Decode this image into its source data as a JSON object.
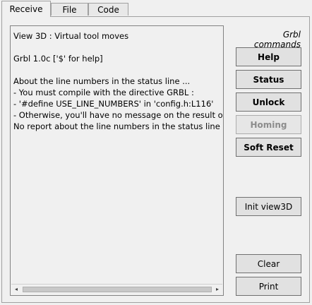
{
  "tabs": [
    {
      "label": "Receive",
      "active": true
    },
    {
      "label": "File",
      "active": false
    },
    {
      "label": "Code",
      "active": false
    }
  ],
  "console": {
    "lines": [
      "View 3D : Virtual tool moves",
      "",
      "Grbl 1.0c ['$' for help]",
      "",
      "About the line numbers in the status line ...",
      "- You must compile with the directive GRBL :",
      "- '#define USE_LINE_NUMBERS' in 'config.h:L116'",
      "- Otherwise, you'll have no message on the result of",
      "No report about the line numbers in the status line !"
    ],
    "scroll_left_arrow": "◂",
    "scroll_right_arrow": "▸"
  },
  "commands": {
    "title": "Grbl commands",
    "help": "Help",
    "status": "Status",
    "unlock": "Unlock",
    "homing_cycle": "Homing Cycle",
    "soft_reset": "Soft Reset",
    "init_view3d": "Init view3D",
    "clear": "Clear",
    "print": "Print"
  }
}
